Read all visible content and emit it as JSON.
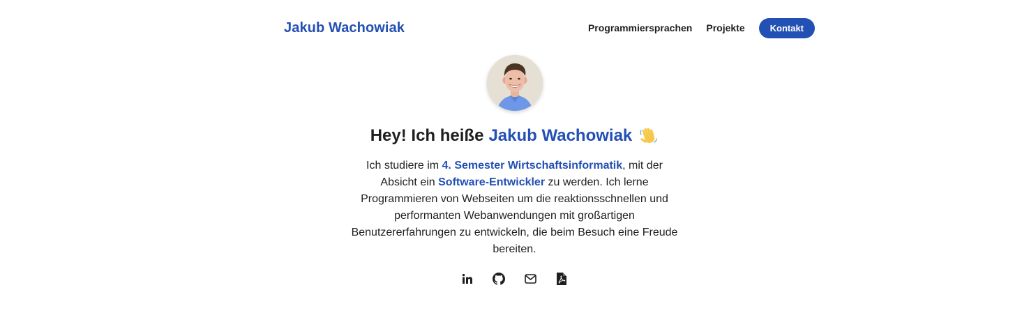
{
  "header": {
    "brand": "Jakub Wachowiak",
    "nav": [
      {
        "label": "Programmiersprachen"
      },
      {
        "label": "Projekte"
      }
    ],
    "contact_button": "Kontakt"
  },
  "hero": {
    "avatar_icon": "profile-photo",
    "headline_prefix": "Hey! Ich heiße",
    "headline_name": "Jakub Wachowiak",
    "headline_emoji": "waving-hand-icon",
    "bio": {
      "part1": "Ich studiere im ",
      "highlight1": "4. Semester Wirtschaftsinformatik",
      "part2": ", mit der Absicht ein ",
      "highlight2": "Software-Entwickler",
      "part3": " zu werden. Ich lerne Programmieren von Webseiten um die reaktionsschnellen und performanten Webanwendungen mit großartigen Benutzererfahrungen zu entwickeln, die beim Besuch eine Freude bereiten."
    }
  },
  "socials": [
    {
      "icon": "linkedin-icon"
    },
    {
      "icon": "github-icon"
    },
    {
      "icon": "mail-icon"
    },
    {
      "icon": "pdf-icon"
    }
  ],
  "colors": {
    "accent": "#2350b5",
    "text": "#1f1f1f",
    "background": "#ffffff"
  }
}
